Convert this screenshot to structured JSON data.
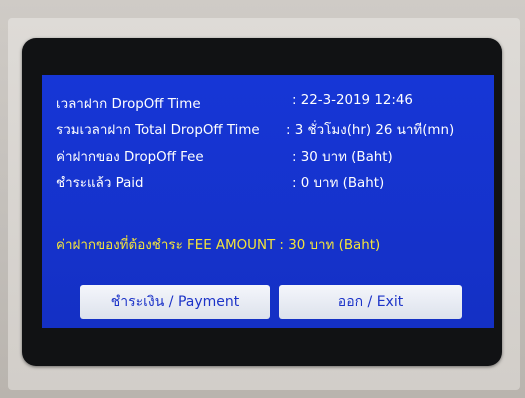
{
  "rows": [
    {
      "label": "เวลาฝาก  DropOff Time",
      "value": ": 22-3-2019  12:46"
    },
    {
      "label": "รวมเวลาฝาก  Total DropOff Time",
      "value": ": 3 ชั่วโมง(hr) 26 นาที(mn)"
    },
    {
      "label": "ค่าฝากของ  DropOff Fee",
      "value": ": 30  บาท (Baht)"
    },
    {
      "label": "ชำระแล้ว  Paid",
      "value": ": 0 บาท (Baht)"
    }
  ],
  "fee_amount": {
    "label": "ค่าฝากของที่ต้องชำระ FEE AMOUNT : 30   บาท (Baht)"
  },
  "buttons": {
    "payment": "ชำระเงิน / Payment",
    "exit": "ออก / Exit"
  }
}
